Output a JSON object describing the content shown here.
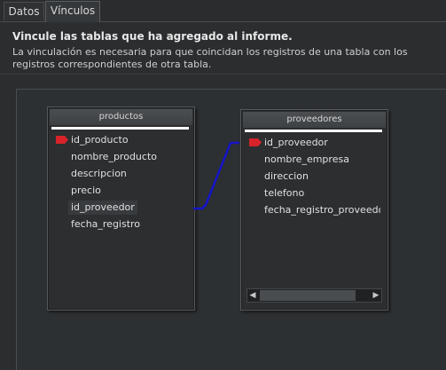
{
  "tabs": [
    {
      "label": "Datos",
      "active": false
    },
    {
      "label": "Vínculos",
      "active": true
    }
  ],
  "header": {
    "title": "Vincule las tablas que ha agregado al informe.",
    "description": "La vinculación es necesaria para que coincidan los registros de una tabla con los registros correspondientes de otra tabla."
  },
  "tables": [
    {
      "name": "productos",
      "fields": [
        "id_producto",
        "nombre_producto",
        "descripcion",
        "precio",
        "id_proveedor",
        "fecha_registro"
      ],
      "key_field": "id_producto",
      "selected_field": "id_proveedor"
    },
    {
      "name": "proveedores",
      "fields": [
        "id_proveedor",
        "nombre_empresa",
        "direccion",
        "telefono",
        "fecha_registro_proveedor"
      ],
      "key_field": "id_proveedor"
    }
  ],
  "link": {
    "from": "productos.id_proveedor",
    "to": "proveedores.id_proveedor",
    "color": "#1414c8"
  },
  "scrollbar_icons": {
    "left": "triangle-left-icon",
    "right": "triangle-right-icon"
  },
  "colors": {
    "key_icon": "#d8232a",
    "background": "#2b2d2f"
  }
}
